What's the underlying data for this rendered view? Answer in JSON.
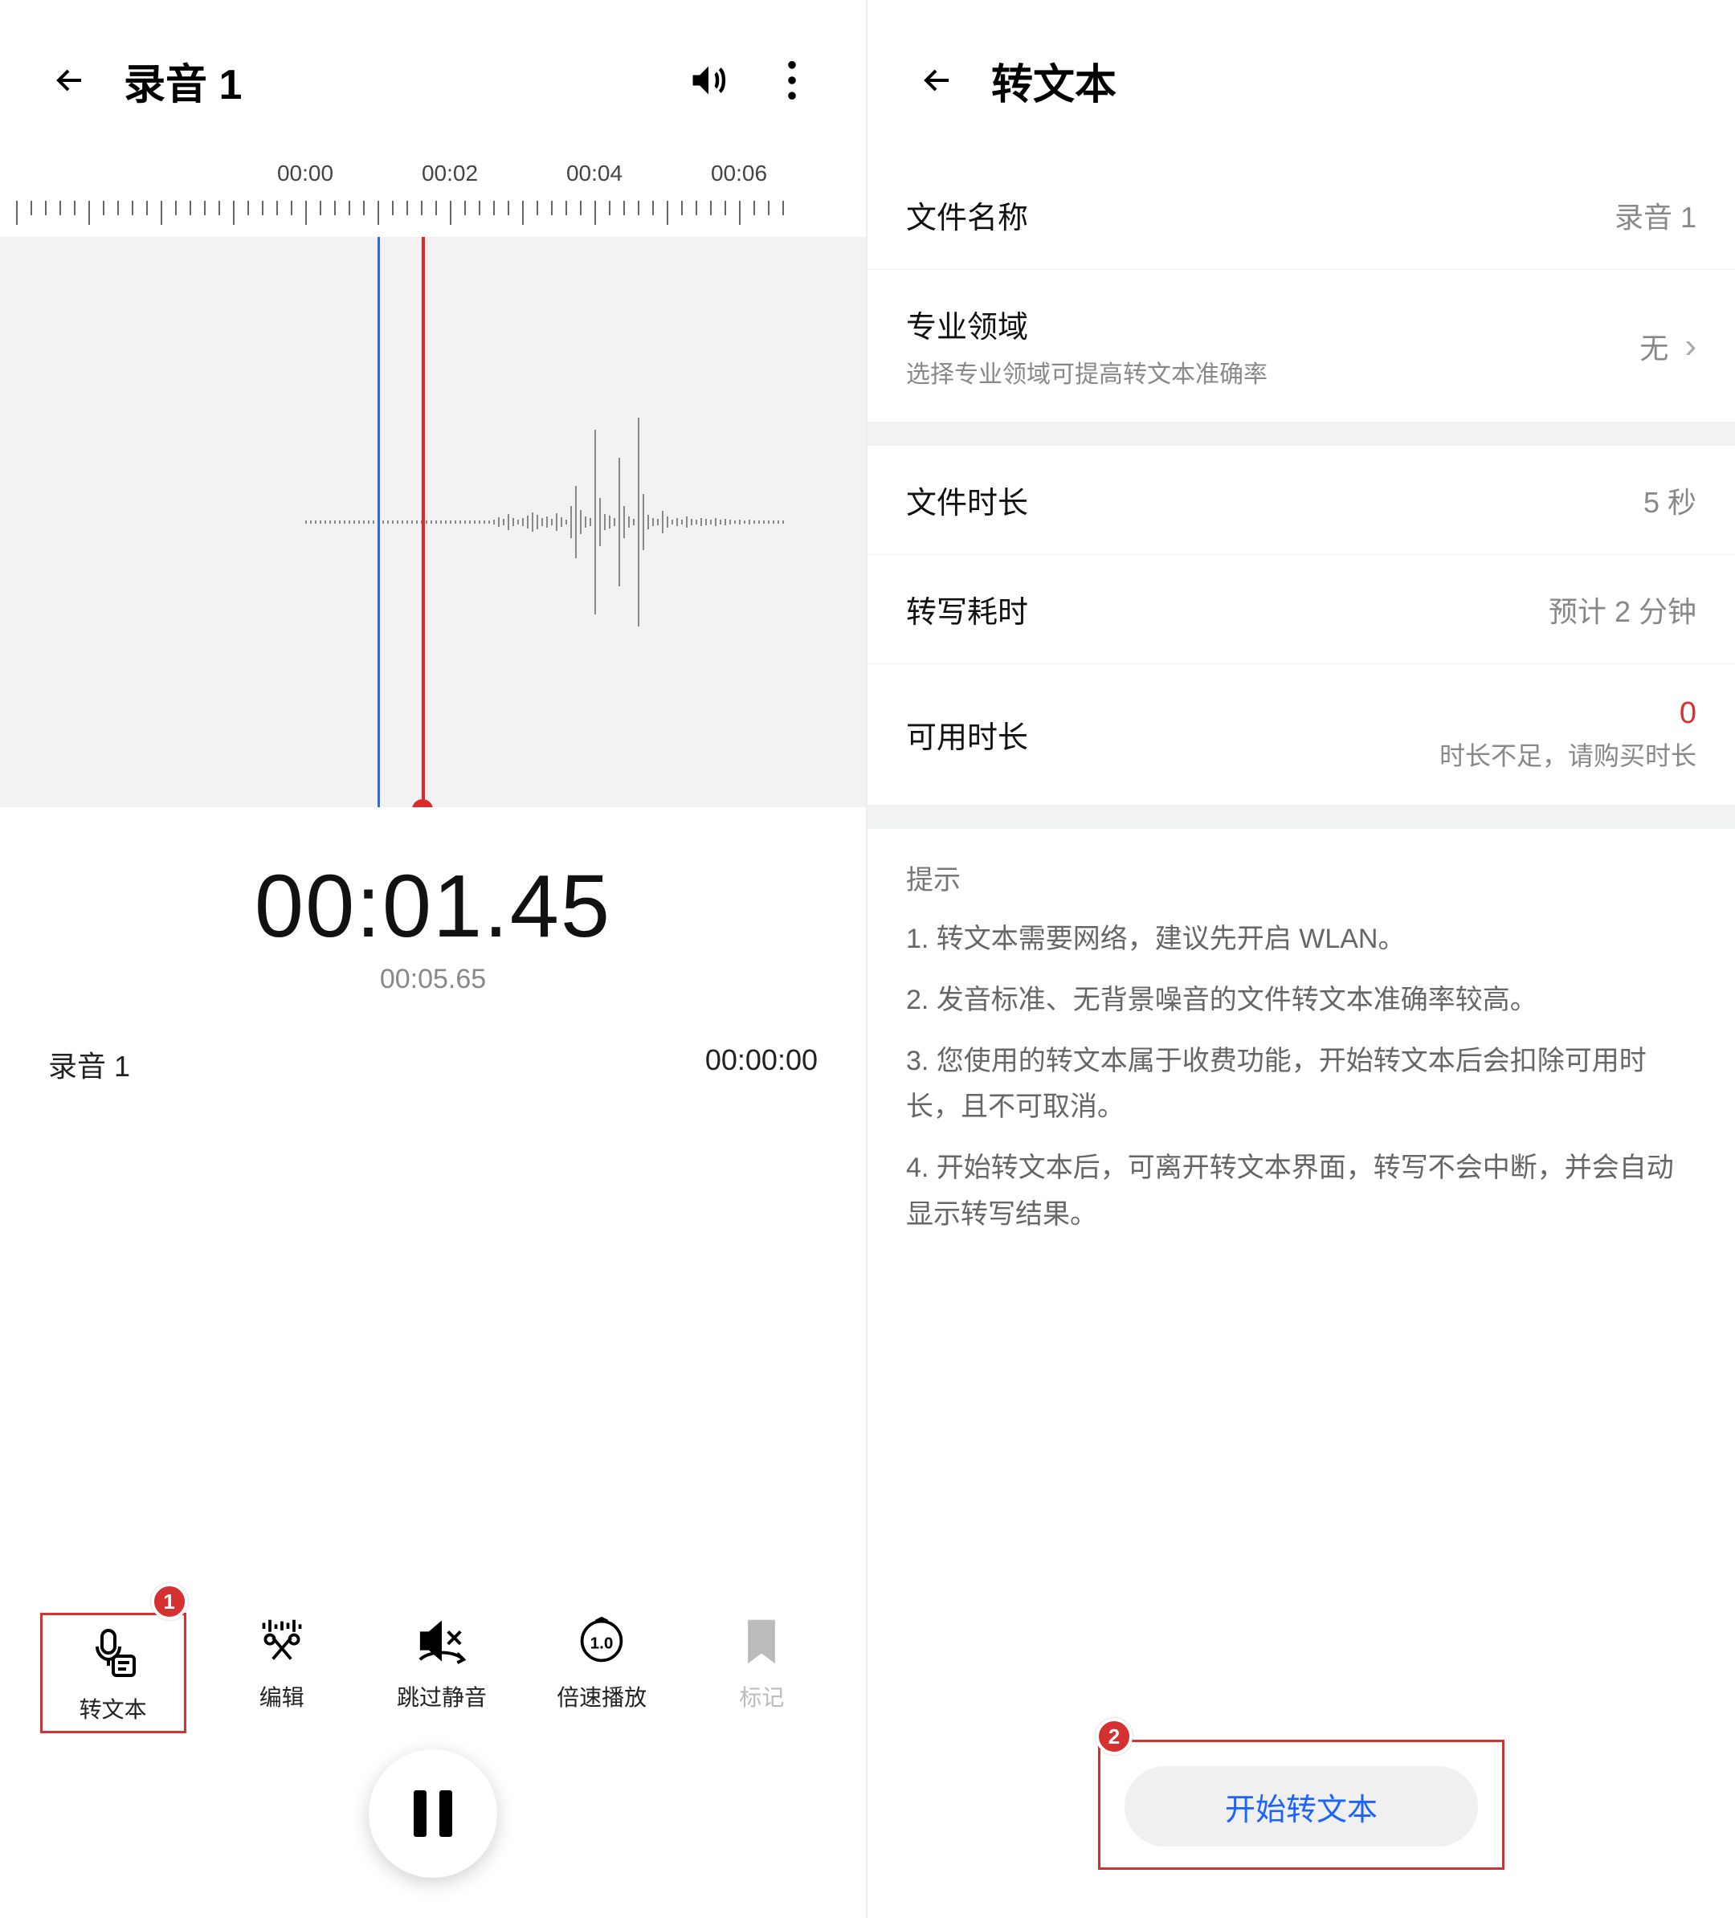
{
  "left": {
    "title": "录音 1",
    "timeline_labels": [
      "00:00",
      "00:02",
      "00:04",
      "00:06"
    ],
    "big_time": "00:01.45",
    "total_time": "00:05.65",
    "rec_name": "录音 1",
    "rec_ts": "00:00:00",
    "tools": {
      "transcribe": "转文本",
      "edit": "编辑",
      "skip_silence": "跳过静音",
      "speed": "倍速播放",
      "mark": "标记"
    },
    "badge1": "1"
  },
  "right": {
    "title": "转文本",
    "file_name_label": "文件名称",
    "file_name_value": "录音 1",
    "domain_label": "专业领域",
    "domain_sub": "选择专业领域可提高转文本准确率",
    "domain_value": "无",
    "duration_label": "文件时长",
    "duration_value": "5 秒",
    "transcribe_time_label": "转写耗时",
    "transcribe_time_value": "预计 2 分钟",
    "available_label": "可用时长",
    "available_value": "0",
    "available_sub": "时长不足，请购买时长",
    "tips_header": "提示",
    "tip1": "1. 转文本需要网络，建议先开启 WLAN。",
    "tip2": "2. 发音标准、无背景噪音的文件转文本准确率较高。",
    "tip3": "3. 您使用的转文本属于收费功能，开始转文本后会扣除可用时长，且不可取消。",
    "tip4": "4. 开始转文本后，可离开转文本界面，转写不会中断，并会自动显示转写结果。",
    "start_btn": "开始转文本",
    "badge2": "2"
  }
}
